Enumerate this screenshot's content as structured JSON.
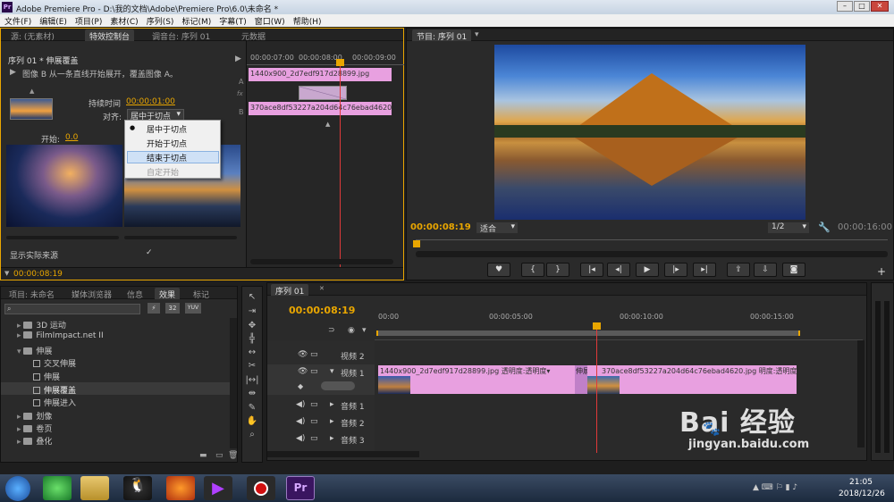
{
  "window": {
    "title": "Adobe Premiere Pro - D:\\我的文档\\Adobe\\Premiere Pro\\6.0\\未命名 *",
    "logo": "Pr"
  },
  "menu": [
    "文件(F)",
    "编辑(E)",
    "项目(P)",
    "素材(C)",
    "序列(S)",
    "标记(M)",
    "字幕(T)",
    "窗口(W)",
    "帮助(H)"
  ],
  "effect_controls": {
    "tabs": [
      "源: (无素材)",
      "特效控制台",
      "调音台: 序列 01",
      "元数据"
    ],
    "header": "序列 01 * 伸展覆盖",
    "description": "图像 B 从一条直线开始展开，覆盖图像 A。",
    "duration_label": "持续时间",
    "duration_value": "00:00:01:00",
    "align_label": "对齐:",
    "align_value": "居中于切点",
    "align_options": [
      "居中于切点",
      "开始于切点",
      "结束于切点",
      "自定开始"
    ],
    "start_label": "开始:",
    "start_value": "0.0",
    "show_actual_sources": "显示实际来源",
    "footer_time": "00:00:08:19",
    "mini_times": [
      "00:00:07:00",
      "00:00:08:00",
      "00:00:09:00"
    ],
    "clip_a": "1440x900_2d7edf917d28899.jpg",
    "clip_b": "370ace8df53227a204d64c76ebad4620.jpg",
    "track_a": "A",
    "track_b": "B",
    "fx": "fx"
  },
  "program": {
    "tab": "节目: 序列 01",
    "timecode": "00:00:08:19",
    "fit": "适合",
    "resolution": "1/2",
    "duration": "00:00:16:00",
    "transport": [
      "marker-icon",
      "mark-in-icon",
      "mark-out-icon",
      "go-to-in-icon",
      "step-back-icon",
      "play-icon",
      "step-forward-icon",
      "go-to-out-icon",
      "lift-icon",
      "extract-icon",
      "camera-icon"
    ],
    "transport_glyphs": [
      "♥",
      "{",
      "}",
      "|◂",
      "◂|",
      "▶",
      "|▸",
      "▸|",
      "⇪",
      "⇩",
      "◙"
    ]
  },
  "project": {
    "tabs": [
      "项目: 未命名",
      "媒体浏览器",
      "信息",
      "效果",
      "标记"
    ],
    "badges": [
      "32",
      "YUV"
    ],
    "tree": [
      {
        "label": "3D 运动",
        "kind": "folder",
        "indent": 0
      },
      {
        "label": "FilmImpact.net II",
        "kind": "folder",
        "indent": 0
      },
      {
        "label": "伸展",
        "kind": "folder",
        "indent": 0
      },
      {
        "label": "交叉伸展",
        "kind": "effect",
        "indent": 1
      },
      {
        "label": "伸展",
        "kind": "effect",
        "indent": 1
      },
      {
        "label": "伸展覆盖",
        "kind": "effect",
        "indent": 1
      },
      {
        "label": "伸展进入",
        "kind": "effect",
        "indent": 1
      },
      {
        "label": "划像",
        "kind": "folder",
        "indent": 0
      },
      {
        "label": "卷页",
        "kind": "folder",
        "indent": 0
      },
      {
        "label": "叠化",
        "kind": "folder",
        "indent": 0
      }
    ]
  },
  "timeline": {
    "tab": "序列 01",
    "timecode": "00:00:08:19",
    "ruler": [
      "00:00",
      "00:00:05:00",
      "00:00:10:00",
      "00:00:15:00"
    ],
    "tracks": [
      "视频 2",
      "视频 1",
      "音频 1",
      "音频 2",
      "音频 3"
    ],
    "clip1": "1440x900_2d7edf917d28899.jpg 透明度:透明度▾",
    "transition": "伸展覆",
    "clip2": "370ace8df53227a204d64c76ebad4620.jpg 明度:透明度▾"
  },
  "taskbar": {
    "time": "21:05",
    "date": "2018/12/26"
  },
  "watermark": {
    "brand": "Bai  经验",
    "url": "jingyan.baidu.com"
  },
  "colors": {
    "accent": "#e9a600",
    "clip": "#e8a0e0",
    "playhead": "#e03a3a"
  }
}
